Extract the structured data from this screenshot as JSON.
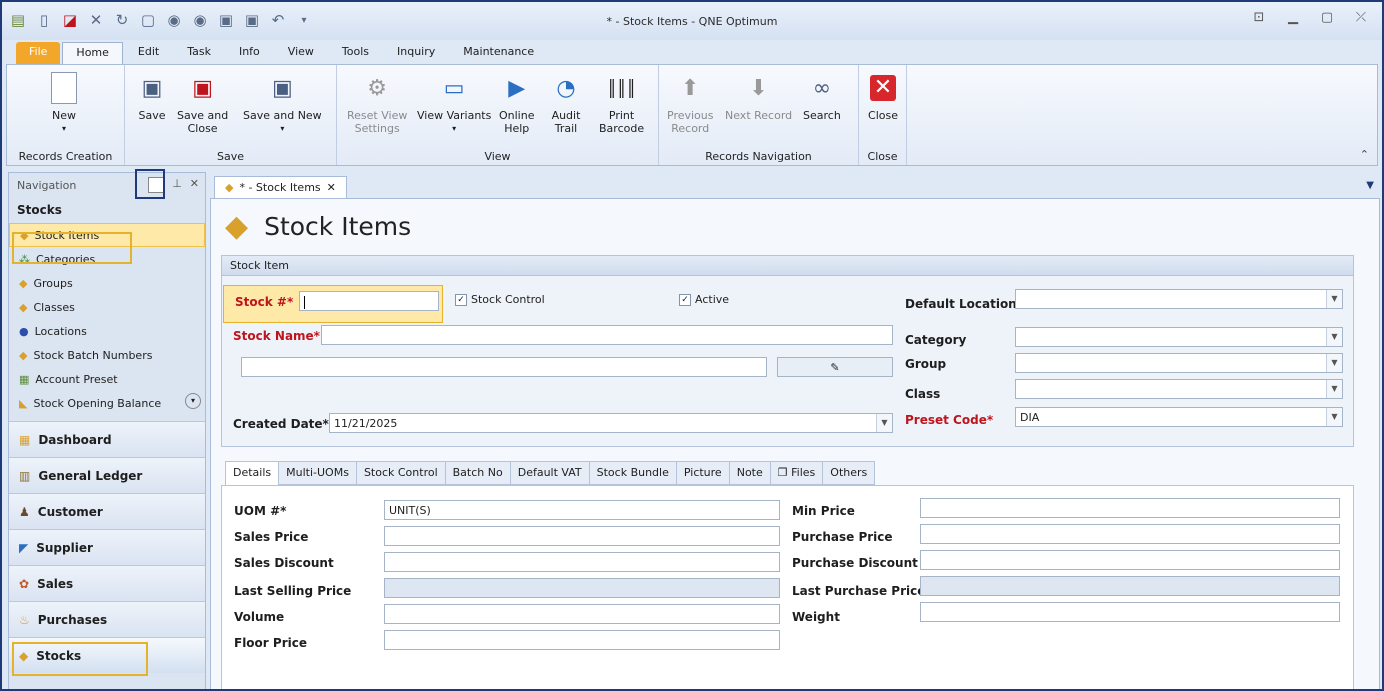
{
  "window": {
    "title": "* - Stock Items - QNE Optimum"
  },
  "ribbon_tabs": [
    "File",
    "Home",
    "Edit",
    "Task",
    "Info",
    "View",
    "Tools",
    "Inquiry",
    "Maintenance"
  ],
  "ribbon": {
    "groups": {
      "records_creation": "Records Creation",
      "save": "Save",
      "view": "View",
      "records_navigation": "Records Navigation",
      "close": "Close"
    },
    "new": "New",
    "save": "Save",
    "save_and_close_1": "Save and",
    "save_and_close_2": "Close",
    "save_and_new": "Save and New",
    "reset_view_1": "Reset View",
    "reset_view_2": "Settings",
    "view_variants": "View Variants",
    "online_help_1": "Online",
    "online_help_2": "Help",
    "audit_trail_1": "Audit",
    "audit_trail_2": "Trail",
    "print_barcode_1": "Print",
    "print_barcode_2": "Barcode",
    "previous_record_1": "Previous",
    "previous_record_2": "Record",
    "next_record": "Next Record",
    "search": "Search",
    "close": "Close"
  },
  "nav": {
    "header": "Navigation",
    "section": "Stocks",
    "items": [
      "Stock Items",
      "Categories",
      "Groups",
      "Classes",
      "Locations",
      "Stock Batch Numbers",
      "Account Preset",
      "Stock Opening Balance"
    ],
    "modules": [
      "Dashboard",
      "General Ledger",
      "Customer",
      "Supplier",
      "Sales",
      "Purchases",
      "Stocks"
    ]
  },
  "doc_tab": "* - Stock Items",
  "page_title": "Stock Items",
  "stock_item": {
    "panel_title": "Stock Item",
    "stock_no_label": "Stock #*",
    "stock_no_value": "",
    "stock_control_label": "Stock Control",
    "active_label": "Active",
    "stock_name_label": "Stock Name*",
    "created_date_label": "Created Date*",
    "created_date_value": "11/21/2025",
    "default_location_label": "Default Location",
    "category_label": "Category",
    "group_label": "Group",
    "class_label": "Class",
    "preset_code_label": "Preset Code*",
    "preset_code_value": "DIA"
  },
  "detail_tabs": [
    "Details",
    "Multi-UOMs",
    "Stock Control",
    "Batch No",
    "Default VAT",
    "Stock Bundle",
    "Picture",
    "Note",
    "Files",
    "Others"
  ],
  "details": {
    "uom_label": "UOM #*",
    "uom_value": "UNIT(S)",
    "sales_price_label": "Sales Price",
    "sales_discount_label": "Sales Discount",
    "last_selling_price_label": "Last Selling Price",
    "volume_label": "Volume",
    "floor_price_label": "Floor Price",
    "min_price_label": "Min Price",
    "purchase_price_label": "Purchase Price",
    "purchase_discount_label": "Purchase Discount",
    "last_purchase_price_label": "Last Purchase Price",
    "weight_label": "Weight"
  }
}
